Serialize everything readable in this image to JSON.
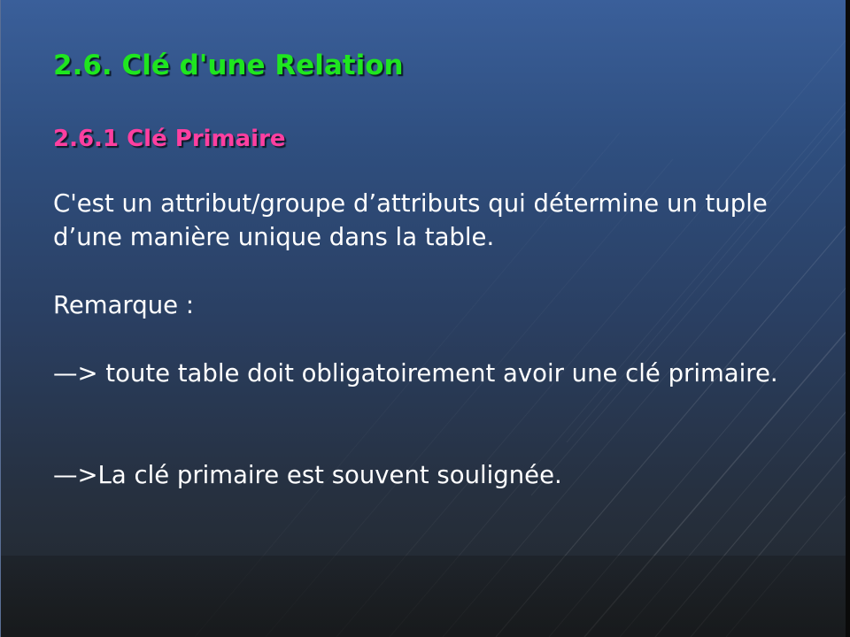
{
  "slide": {
    "title": "2.6. Clé d'une Relation",
    "subtitle": "2.6.1 Clé Primaire",
    "definition": "C'est un attribut/groupe d’attributs qui détermine un tuple d’une manière unique dans la table.",
    "remark_label": "Remarque :",
    "remark_1": "—> toute table doit obligatoirement avoir une clé primaire.",
    "remark_2": "—>La clé primaire est souvent soulignée."
  },
  "colors": {
    "title": "#1fe61f",
    "subtitle": "#ff3fa0",
    "body_text": "#ffffff",
    "background_top": "#3a5f9a",
    "background_bottom": "#222629"
  }
}
